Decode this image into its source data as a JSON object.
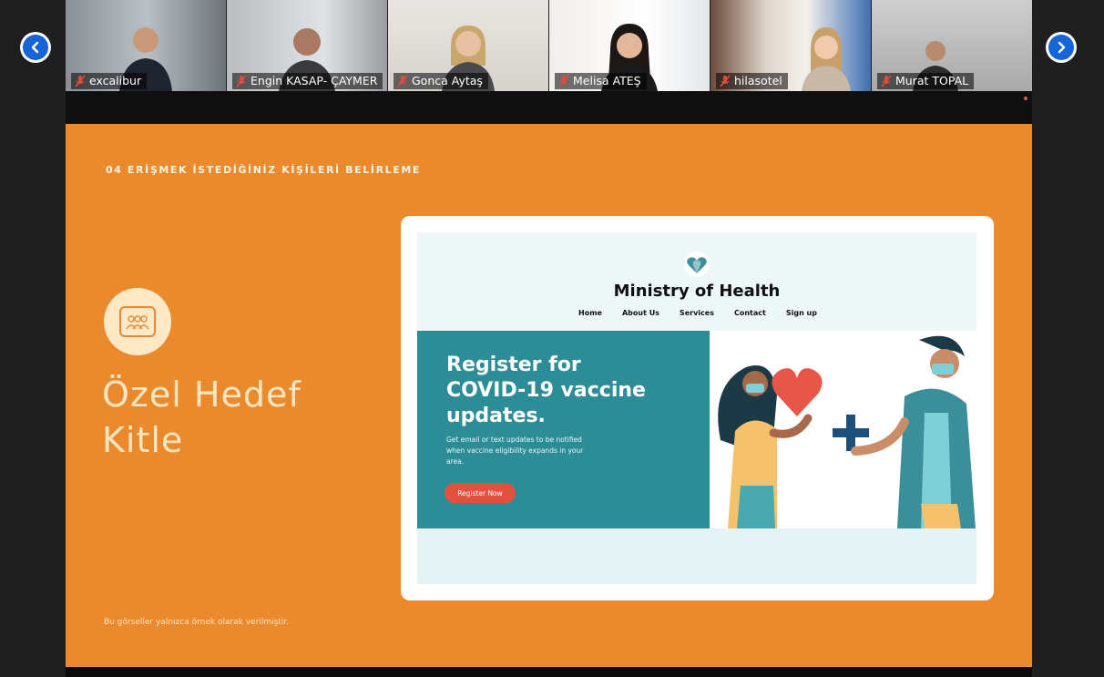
{
  "participants": [
    {
      "name": "excalibur"
    },
    {
      "name": "Engin KASAP- ÇAYMER"
    },
    {
      "name": "Gonca Aytaş"
    },
    {
      "name": "Melisa ATEŞ"
    },
    {
      "name": "hilasotel"
    },
    {
      "name": "Murat TOPAL"
    }
  ],
  "slide": {
    "heading": "04 ERİŞMEK İSTEDİĞİNİZ KİŞİLERİ BELİRLEME",
    "title_line1": "Özel Hedef",
    "title_line2": "Kitle",
    "footer_note": "Bu görseller yalnızca örnek olarak verilmiştir."
  },
  "mock_site": {
    "title": "Ministry of Health",
    "nav": [
      "Home",
      "About Us",
      "Services",
      "Contact",
      "Sign up"
    ],
    "hero_title_line1": "Register for",
    "hero_title_line2": "COVID-19 vaccine",
    "hero_title_line3": "updates.",
    "hero_text": "Get email or text updates to be notified when vaccine eligibility expands in your area.",
    "cta_label": "Register Now"
  },
  "colors": {
    "slide_bg": "#ea8a2c",
    "hero_bg": "#2d8d97",
    "cta": "#e3513e",
    "nav_button": "#1565d8"
  },
  "icons": {
    "prev": "chevron-left-icon",
    "next": "chevron-right-icon",
    "muted": "mic-muted-icon",
    "badge": "people-group-icon"
  }
}
